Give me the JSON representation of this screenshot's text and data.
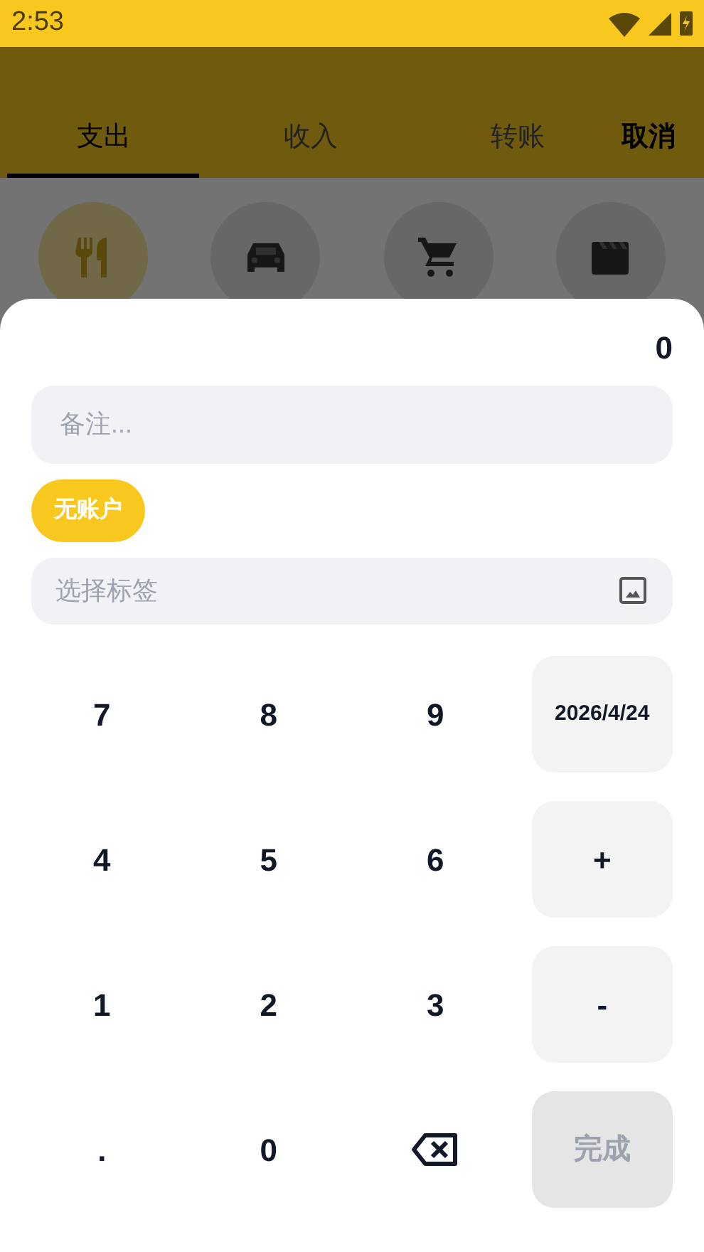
{
  "status_bar": {
    "time": "2:53"
  },
  "tabs": [
    {
      "label": "支出",
      "selected": true
    },
    {
      "label": "收入",
      "selected": false
    },
    {
      "label": "转账",
      "selected": false
    }
  ],
  "cancel_button": "取消",
  "categories": [
    {
      "kind": "dining",
      "selected": true
    },
    {
      "kind": "car",
      "selected": false
    },
    {
      "kind": "cart",
      "selected": false
    },
    {
      "kind": "movie",
      "selected": false
    }
  ],
  "amount": "0",
  "note": {
    "placeholder": "备注..."
  },
  "account_chip": "无账户",
  "tag_field": {
    "placeholder": "选择标签"
  },
  "keypad": [
    {
      "kind": "key",
      "label": "7"
    },
    {
      "kind": "key",
      "label": "8"
    },
    {
      "kind": "key",
      "label": "9"
    },
    {
      "kind": "side",
      "label": "2026/4/24"
    },
    {
      "kind": "key",
      "label": "4"
    },
    {
      "kind": "key",
      "label": "5"
    },
    {
      "kind": "key",
      "label": "6"
    },
    {
      "kind": "side",
      "label": "+"
    },
    {
      "kind": "key",
      "label": "1"
    },
    {
      "kind": "key",
      "label": "2"
    },
    {
      "kind": "key",
      "label": "3"
    },
    {
      "kind": "side",
      "label": "-"
    },
    {
      "kind": "key",
      "label": "."
    },
    {
      "kind": "key",
      "label": "0"
    },
    {
      "kind": "backspace"
    },
    {
      "kind": "done",
      "label": "完成",
      "disabled": true
    }
  ]
}
